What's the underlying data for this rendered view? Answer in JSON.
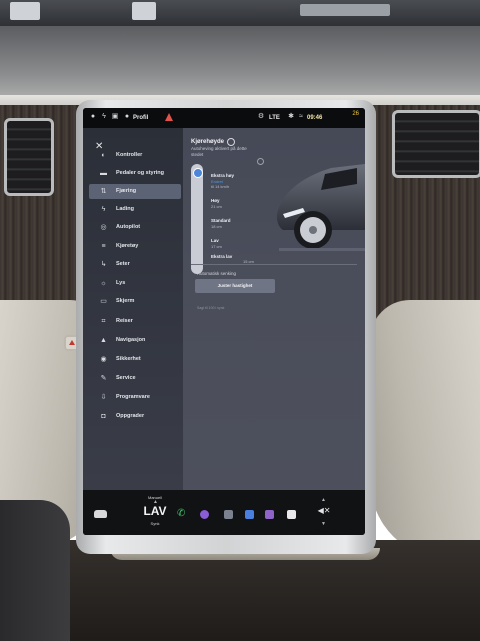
{
  "status_bar": {
    "profile_label": "Profil",
    "network": "LTE",
    "time": "09:46",
    "outside_temp": "26"
  },
  "sidebar": {
    "items": [
      {
        "label": "Kontroller",
        "icon": "toggle-icon",
        "active": false
      },
      {
        "label": "Pedaler og styring",
        "icon": "car-icon",
        "active": false
      },
      {
        "label": "Fjæring",
        "icon": "suspension-icon",
        "active": true
      },
      {
        "label": "Lading",
        "icon": "bolt-icon",
        "active": false
      },
      {
        "label": "Autopilot",
        "icon": "steering-wheel-icon",
        "active": false
      },
      {
        "label": "Kjøretøy",
        "icon": "sliders-icon",
        "active": false
      },
      {
        "label": "Seter",
        "icon": "seat-icon",
        "active": false
      },
      {
        "label": "Lys",
        "icon": "light-icon",
        "active": false
      },
      {
        "label": "Skjerm",
        "icon": "display-icon",
        "active": false
      },
      {
        "label": "Reiser",
        "icon": "trips-icon",
        "active": false
      },
      {
        "label": "Navigasjon",
        "icon": "navigation-icon",
        "active": false
      },
      {
        "label": "Sikkerhet",
        "icon": "lock-icon",
        "active": false
      },
      {
        "label": "Service",
        "icon": "wrench-icon",
        "active": false
      },
      {
        "label": "Programvare",
        "icon": "download-icon",
        "active": false
      },
      {
        "label": "Oppgrader",
        "icon": "bag-icon",
        "active": false
      }
    ]
  },
  "suspension": {
    "title": "Kjørehøyde",
    "subtitle": "Autoheving aktivert på dette stedet",
    "levels": [
      {
        "name": "Ekstra høy",
        "detail": "Endret",
        "detail_note": "til 14 km/h"
      },
      {
        "name": "Høy",
        "detail": "21 cm"
      },
      {
        "name": "Standard",
        "detail": "18 cm"
      },
      {
        "name": "Lav",
        "detail": "17 cm"
      },
      {
        "name": "Ekstra lav",
        "detail": "15 cm"
      }
    ],
    "auto_label": "Automatisk senking",
    "speed_button": "Juster hastighet",
    "footnote": "Sagt til 100 i synk"
  },
  "dock": {
    "manual_label": "Manuell",
    "temperature": "LAV",
    "sync_label": "Synk"
  },
  "colors": {
    "accent": "#4b86d8",
    "active_item": "#5b6375",
    "panel": "#4a4d5a"
  }
}
